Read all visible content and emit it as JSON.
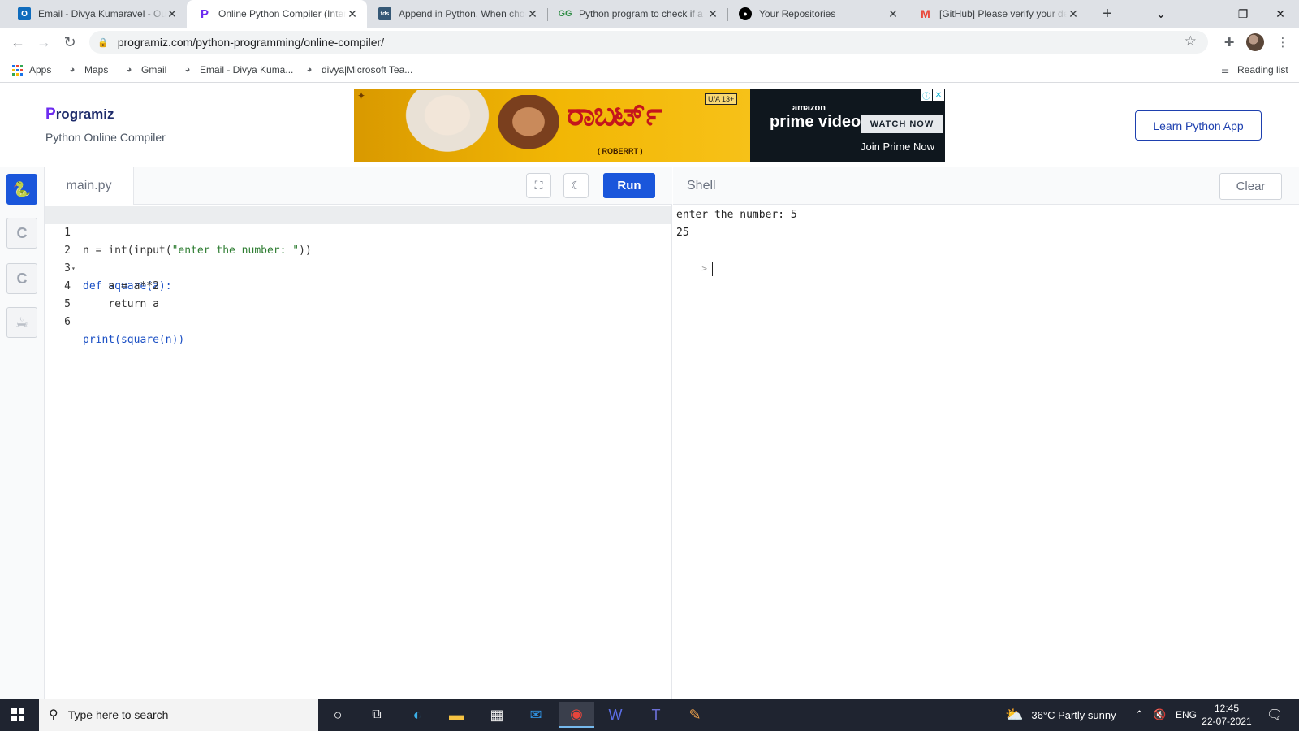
{
  "browser": {
    "tabs": [
      {
        "title": "Email - Divya Kumaravel - Outlook",
        "icon": "outlook-icon",
        "color": "#0f6cbd"
      },
      {
        "title": "Online Python Compiler (Interpreter)",
        "icon": "programiz-icon",
        "color": "#6d2cf0"
      },
      {
        "title": "Append in Python. When choosing",
        "icon": "tds-icon",
        "color": "#355876"
      },
      {
        "title": "Python program to check if a",
        "icon": "geeksforgeeks-icon",
        "color": "#2f8d46"
      },
      {
        "title": "Your Repositories",
        "icon": "github-icon",
        "color": "#000000"
      },
      {
        "title": "[GitHub] Please verify your device",
        "icon": "gmail-icon",
        "color": "#ea4335"
      }
    ],
    "active_tab": 1,
    "url": "programiz.com/python-programming/online-compiler/",
    "bookmarks": [
      {
        "label": "Apps",
        "icon": "apps-grid-icon"
      },
      {
        "label": "Maps",
        "icon": "globe-icon"
      },
      {
        "label": "Gmail",
        "icon": "globe-icon"
      },
      {
        "label": "Email - Divya Kuma...",
        "icon": "globe-icon"
      },
      {
        "label": "divya|Microsoft Tea...",
        "icon": "globe-icon"
      }
    ],
    "reading_list": "Reading list"
  },
  "header": {
    "logo_p": "P",
    "logo_text": "rogramiz",
    "subtitle": "Python Online Compiler",
    "learn_button": "Learn Python App",
    "ad": {
      "rating": "U/A 13+",
      "film_title": "ರಾಬರ್ಟ್",
      "film_subtitle": "( ROBERRT )",
      "amazon": "amazon",
      "prime": "prime video",
      "watch_now": "WATCH NOW",
      "join": "Join Prime Now"
    }
  },
  "editor": {
    "file_name": "main.py",
    "run_label": "Run",
    "line_numbers": [
      "1",
      "2",
      "3",
      "4",
      "5",
      "6"
    ],
    "lines": [
      "n = int(input(\"enter the number: \"))",
      "def square(a):",
      "    a = a**2",
      "    return a",
      "",
      "print(square(n))"
    ]
  },
  "shell": {
    "title": "Shell",
    "clear_label": "Clear",
    "output": [
      "enter the number: 5",
      "25"
    ],
    "prompt": ">"
  },
  "taskbar": {
    "search_placeholder": "Type here to search",
    "weather": "36°C  Partly sunny",
    "language": "ENG",
    "time": "12:45",
    "date": "22-07-2021"
  }
}
